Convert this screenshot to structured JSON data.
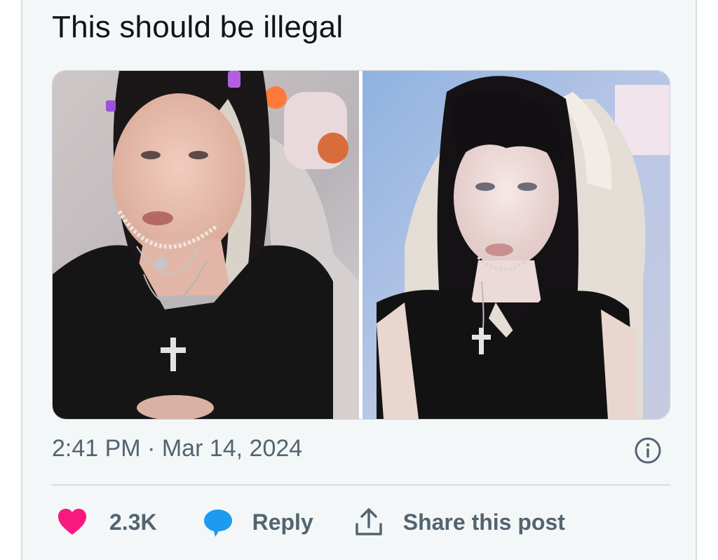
{
  "post": {
    "text": "This should be illegal",
    "timestamp": "2:41 PM · Mar 14, 2024"
  },
  "media": {
    "images": [
      {
        "name": "photo-left"
      },
      {
        "name": "photo-right"
      }
    ]
  },
  "actions": {
    "like_count": "2.3K",
    "reply_label": "Reply",
    "share_label": "Share this post"
  },
  "icons": {
    "info": "info-icon",
    "like": "heart-icon",
    "reply": "speech-bubble-icon",
    "share": "share-arrow-icon"
  },
  "colors": {
    "like": "#f91880",
    "reply": "#1d9bf0",
    "text": "#0f1419",
    "secondary": "#536471"
  }
}
